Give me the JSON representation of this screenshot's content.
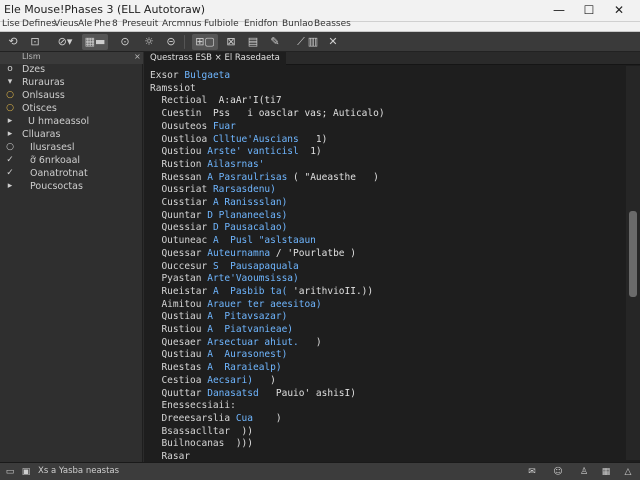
{
  "window": {
    "title": "Ele Mouse!Phases 3 (ELL Autotoraw)",
    "controls": {
      "minimize": "—",
      "maximize": "☐",
      "close": "✕"
    }
  },
  "menu": {
    "items": [
      "Lise",
      "Defines",
      "Vieus",
      "Ale",
      "Phe",
      "8",
      "Preseuit",
      "Arcmnus",
      "Fulbiole",
      "Enidfon",
      "Bunlao",
      "Beasses"
    ]
  },
  "toolbar": {
    "icons": [
      "save-icon",
      "open-icon",
      "find-icon",
      "layout-icon",
      "sync-icon",
      "settings-icon",
      "view-icon",
      "filter-icon",
      "edit-icon",
      "pen-icon",
      "grid-icon",
      "close-icon"
    ]
  },
  "sidebar": {
    "header_label": "Llsm",
    "items": [
      {
        "icon": "o",
        "label": "Dzes"
      },
      {
        "icon": "▾",
        "label": "Rurauras"
      },
      {
        "icon": "○",
        "label": "Onlsauss"
      },
      {
        "icon": "○",
        "label": "Otisces"
      },
      {
        "icon": "▸",
        "label": "U hmaeassol"
      },
      {
        "icon": "▸",
        "label": "Clluaras"
      },
      {
        "icon": "○",
        "label": "Ilusrasesl"
      },
      {
        "icon": "✓",
        "label": "ỡ 6nrkoaal"
      },
      {
        "icon": "✓",
        "label": "Oanatrotnat"
      },
      {
        "icon": "▸",
        "label": "Poucsoctas"
      }
    ]
  },
  "tabs": [
    {
      "label": "Questrass  ESB  ×  El Rasedaeta"
    }
  ],
  "code": [
    {
      "k": "Exsor",
      "v": "Bulgaeta",
      "p": ""
    },
    {
      "k": "Ramssiot",
      "v": "",
      "p": ""
    },
    {
      "k": "  Rectioal",
      "v": "",
      "p": "A:aAr'I(ti7"
    },
    {
      "k": "  Cuestin",
      "v": "",
      "p": "Pss   i oasclar vas; Auticalo)"
    },
    {
      "k": "  Ousuteos",
      "v": "Fuar",
      "p": ""
    },
    {
      "k": "  Oustlioa",
      "v": "Clltue'Auscians",
      "p": "  1)"
    },
    {
      "k": "  Qustiou",
      "v": "Arste' vanticisl",
      "p": " 1)"
    },
    {
      "k": "  Rustion",
      "v": "Ailasrnas'",
      "p": ""
    },
    {
      "k": "  Ruessan",
      "v": "A Pasraulrisas",
      "p": "( \"Aueasthe   )"
    },
    {
      "k": "  Oussriat",
      "v": "Rarsasdenu)",
      "p": ""
    },
    {
      "k": "  Cusstiar",
      "v": "A Ranissslan)",
      "p": ""
    },
    {
      "k": "  Quuntar",
      "v": "D Plananeelas)",
      "p": ""
    },
    {
      "k": "  Quessiar",
      "v": "D Pausacalao)",
      "p": ""
    },
    {
      "k": "  Outuneac",
      "v": "A  Pusl \"aslstaaun",
      "p": ""
    },
    {
      "k": "  Quessar",
      "v": "Auteurnamna",
      "p": "/ 'Pourlatbe )"
    },
    {
      "k": "  Ouccesur",
      "v": "S  Pausapaquala",
      "p": ""
    },
    {
      "k": "  Pyastan",
      "v": "Arte'Vaoumsissa)",
      "p": ""
    },
    {
      "k": "  Rueistar",
      "v": "A  Pasbib ta(",
      "p": "'arithvioII.))"
    },
    {
      "k": "  Aimitou",
      "v": "Arauer ter aeesitoa)",
      "p": ""
    },
    {
      "k": "  Qustiau",
      "v": "A  Pitavsazar)",
      "p": ""
    },
    {
      "k": "  Rustiou",
      "v": "A  Piatvanieae)",
      "p": ""
    },
    {
      "k": "  Quesaer",
      "v": "Arsectuar ahiut.",
      "p": "  )"
    },
    {
      "k": "  Qustiau",
      "v": "A  Aurasonest)",
      "p": ""
    },
    {
      "k": "  Ruestas",
      "v": "A  Raraiealp)",
      "p": ""
    },
    {
      "k": "  Cestioa",
      "v": "Aecsari)",
      "p": "  )"
    },
    {
      "k": "  Quuttar",
      "v": "Danasatsd  ",
      "p": "Pauio' ashisI)"
    },
    {
      "k": "  Enessecsiaii:",
      "v": "",
      "p": ""
    },
    {
      "k": "  Dreeesarslia",
      "v": "Cua",
      "p": "   )"
    },
    {
      "k": "  Bsassaclltar",
      "v": "",
      "p": "))"
    },
    {
      "k": "  Builnocanas",
      "v": "",
      "p": ")))"
    },
    {
      "k": "  Rasar",
      "v": "",
      "p": ""
    }
  ],
  "status": {
    "left": "Xs a  Yasba neastas",
    "right_icons": [
      "note-icon",
      "chat-icon",
      "user-icon",
      "grid-icon"
    ]
  }
}
